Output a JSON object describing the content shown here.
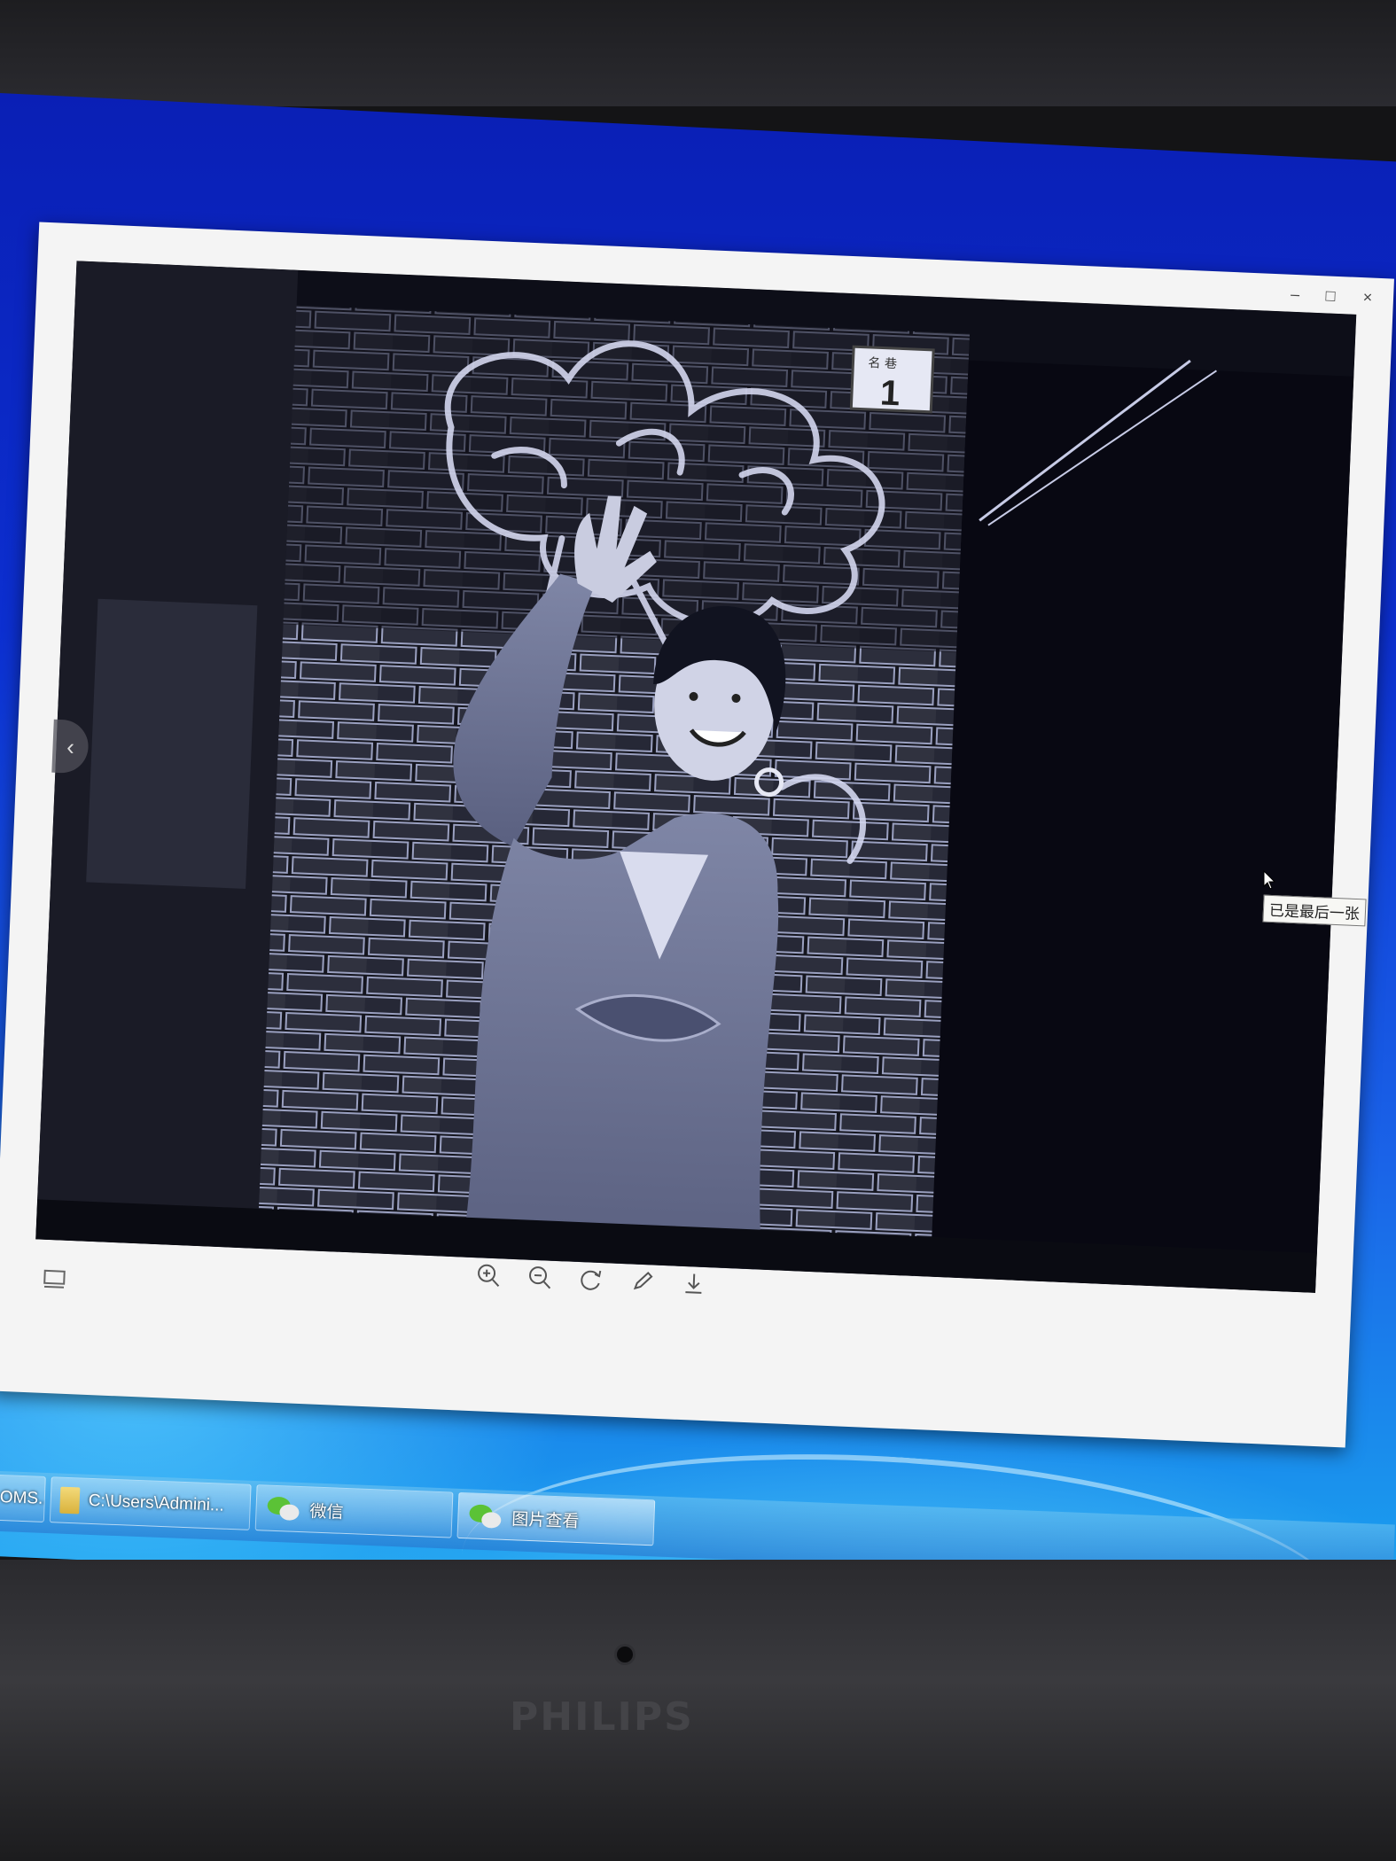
{
  "window": {
    "minimize": "–",
    "maximize": "□",
    "close": "×"
  },
  "photo": {
    "house_number": "1",
    "plate_small_text": "名 巷"
  },
  "viewer": {
    "prev_arrow": "‹",
    "tooltip": "已是最后一张",
    "toolbar": [
      "zoom-in",
      "zoom-out",
      "rotate",
      "edit",
      "download"
    ]
  },
  "taskbar": {
    "items": [
      {
        "label": "OMS..."
      },
      {
        "label": "C:\\Users\\Admini..."
      },
      {
        "label": "微信"
      },
      {
        "label": "图片查看"
      }
    ]
  },
  "monitor": {
    "brand": "PHILIPS"
  }
}
